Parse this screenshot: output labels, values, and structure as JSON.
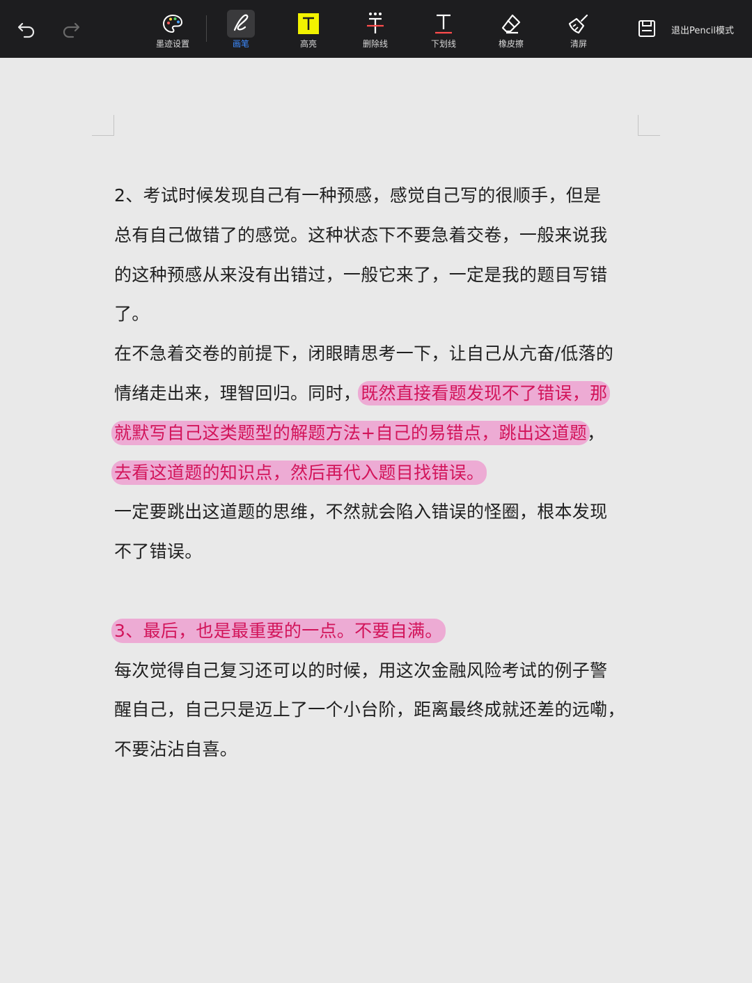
{
  "toolbar": {
    "tools": [
      {
        "id": "ink-settings",
        "label": "墨迹设置",
        "icon": "palette-icon"
      },
      {
        "id": "pen",
        "label": "画笔",
        "icon": "pen-icon",
        "active": true
      },
      {
        "id": "highlight",
        "label": "高亮",
        "icon": "highlight-icon"
      },
      {
        "id": "strikethrough",
        "label": "删除线",
        "icon": "strikethrough-icon"
      },
      {
        "id": "underline",
        "label": "下划线",
        "icon": "underline-icon"
      },
      {
        "id": "eraser",
        "label": "橡皮擦",
        "icon": "eraser-icon"
      },
      {
        "id": "clear",
        "label": "清屏",
        "icon": "broom-icon"
      }
    ],
    "exit_label": "退出Pencil模式",
    "accent_color": "#3d8bff",
    "highlight_tool_color": "#f2f200"
  },
  "document": {
    "highlight_color": "#f078c3",
    "highlight_text_color": "#d2145a",
    "lines": [
      {
        "text": "2、考试时候发现自己有一种预感，感觉自己写的很顺手，但是"
      },
      {
        "text": "总有自己做错了的感觉。这种状态下不要急着交卷，一般来说我"
      },
      {
        "text": "的这种预感从来没有出错过，一般它来了，一定是我的题目写错"
      },
      {
        "text": "了。"
      },
      {
        "text": "在不急着交卷的前提下，闭眼睛思考一下，让自己从亢奋/低落的"
      },
      {
        "text": "情绪走出来，理智回归。同时，",
        "hl": "既然直接看题发现不了错误，那"
      },
      {
        "hl": "就默写自己这类题型的解题方法+自己的易错点，跳出这道题",
        "text_after": "，"
      },
      {
        "hl": "去看这道题的知识点，然后再代入题目找错误。"
      },
      {
        "text": "一定要跳出这道题的思维，不然就会陷入错误的怪圈，根本发现"
      },
      {
        "text": "不了错误。"
      },
      {
        "hl": "3、最后，也是最重要的一点。不要自满。"
      },
      {
        "text": "每次觉得自己复习还可以的时候，用这次金融风险考试的例子警"
      },
      {
        "text": "醒自己，自己只是迈上了一个小台阶，距离最终成就还差的远嘞，"
      },
      {
        "text": "不要沾沾自喜。"
      }
    ]
  }
}
